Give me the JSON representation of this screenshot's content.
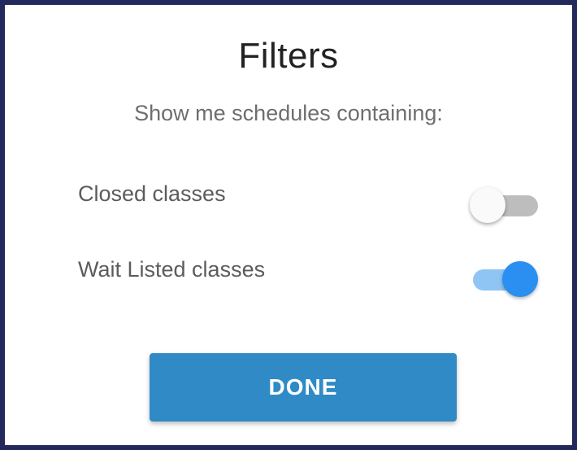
{
  "dialog": {
    "title": "Filters",
    "subtitle": "Show me schedules containing:",
    "filters": [
      {
        "label": "Closed classes",
        "enabled": false
      },
      {
        "label": "Wait Listed classes",
        "enabled": true
      }
    ],
    "done_label": "DONE"
  },
  "colors": {
    "frame_border": "#23295a",
    "toggle_on_knob": "#2a8ff0",
    "toggle_on_track": "#8ec5f5",
    "toggle_off_knob": "#fafafa",
    "toggle_off_track": "#bdbdbd",
    "button_background": "#2f8ac6",
    "button_text": "#ffffff"
  }
}
